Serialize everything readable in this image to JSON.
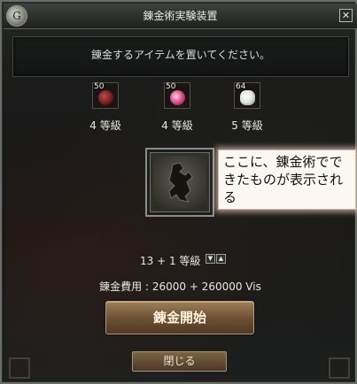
{
  "window": {
    "title": "錬金術実験装置",
    "logo_glyph": "G",
    "close_glyph": "✕"
  },
  "message": "錬金するアイテムを置いてください。",
  "ingredients": [
    {
      "count": "50",
      "grade": "4 等級",
      "gem_color": "#7a1f22"
    },
    {
      "count": "50",
      "grade": "4 等級",
      "gem_color": "#e0588f"
    },
    {
      "count": "64",
      "grade": "5 等級",
      "gem_color": "#e8ece8"
    }
  ],
  "result": {
    "annotation": "ここに、錬金術でできたものが表示される",
    "grade": "13 + 1 等級",
    "down_glyph": "▼",
    "up_glyph": "▲"
  },
  "cost": "錬金費用 : 26000 + 260000 Vis",
  "buttons": {
    "start": "錬金開始",
    "close": "閉じる"
  },
  "colors": {
    "accent": "#8d6f4c",
    "text": "#e6e6de"
  }
}
